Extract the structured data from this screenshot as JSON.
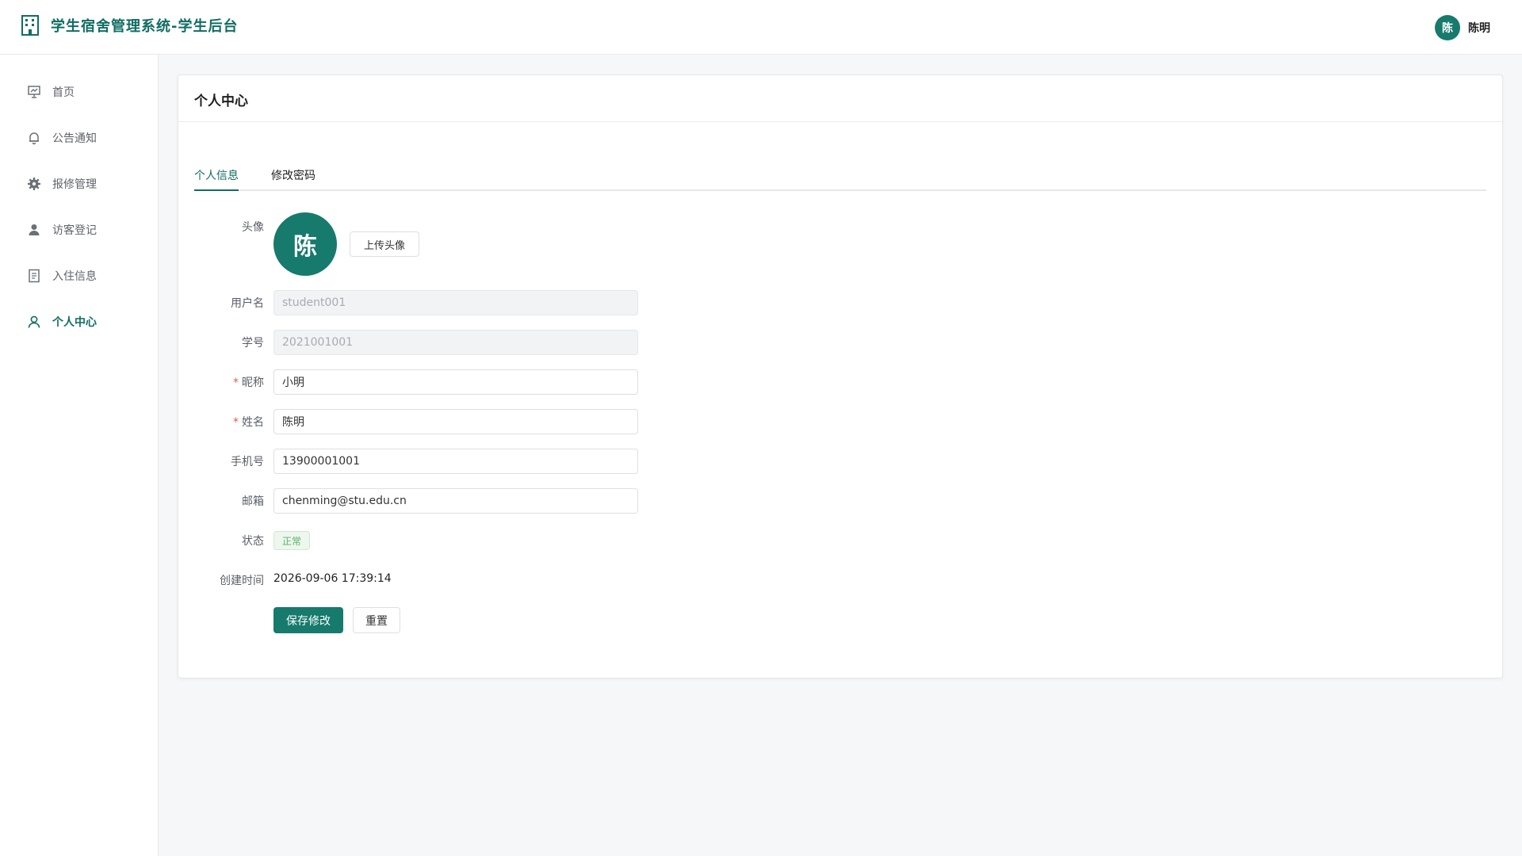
{
  "header": {
    "title": "学生宿舍管理系统-学生后台",
    "user": {
      "avatar_text": "陈",
      "name": "陈明"
    }
  },
  "sidebar": {
    "items": [
      {
        "label": "首页",
        "icon": "presentation-board-icon",
        "active": false
      },
      {
        "label": "公告通知",
        "icon": "bell-icon",
        "active": false
      },
      {
        "label": "报修管理",
        "icon": "gear-icon",
        "active": false
      },
      {
        "label": "访客登记",
        "icon": "user-icon",
        "active": false
      },
      {
        "label": "入住信息",
        "icon": "document-icon",
        "active": false
      },
      {
        "label": "个人中心",
        "icon": "user-outline-icon",
        "active": true
      }
    ]
  },
  "main": {
    "card_title": "个人中心",
    "tabs": [
      {
        "label": "个人信息",
        "active": true
      },
      {
        "label": "修改密码",
        "active": false
      }
    ],
    "form": {
      "avatar_label": "头像",
      "avatar_text": "陈",
      "upload_label": "上传头像",
      "username": {
        "label": "用户名",
        "value": "student001",
        "disabled": true
      },
      "student_no": {
        "label": "学号",
        "value": "2021001001",
        "disabled": true
      },
      "nickname": {
        "label": "昵称",
        "value": "小明",
        "required": true
      },
      "real_name": {
        "label": "姓名",
        "value": "陈明",
        "required": true
      },
      "phone": {
        "label": "手机号",
        "value": "13900001001"
      },
      "email": {
        "label": "邮箱",
        "value": "chenming@stu.edu.cn"
      },
      "status": {
        "label": "状态",
        "value": "正常"
      },
      "created": {
        "label": "创建时间",
        "value": "2026-09-06 17:39:14"
      },
      "save_label": "保存修改",
      "reset_label": "重置"
    }
  },
  "colors": {
    "brand": "#116d63",
    "brand_fill": "#167a6c",
    "status_text": "#5ab26a"
  }
}
